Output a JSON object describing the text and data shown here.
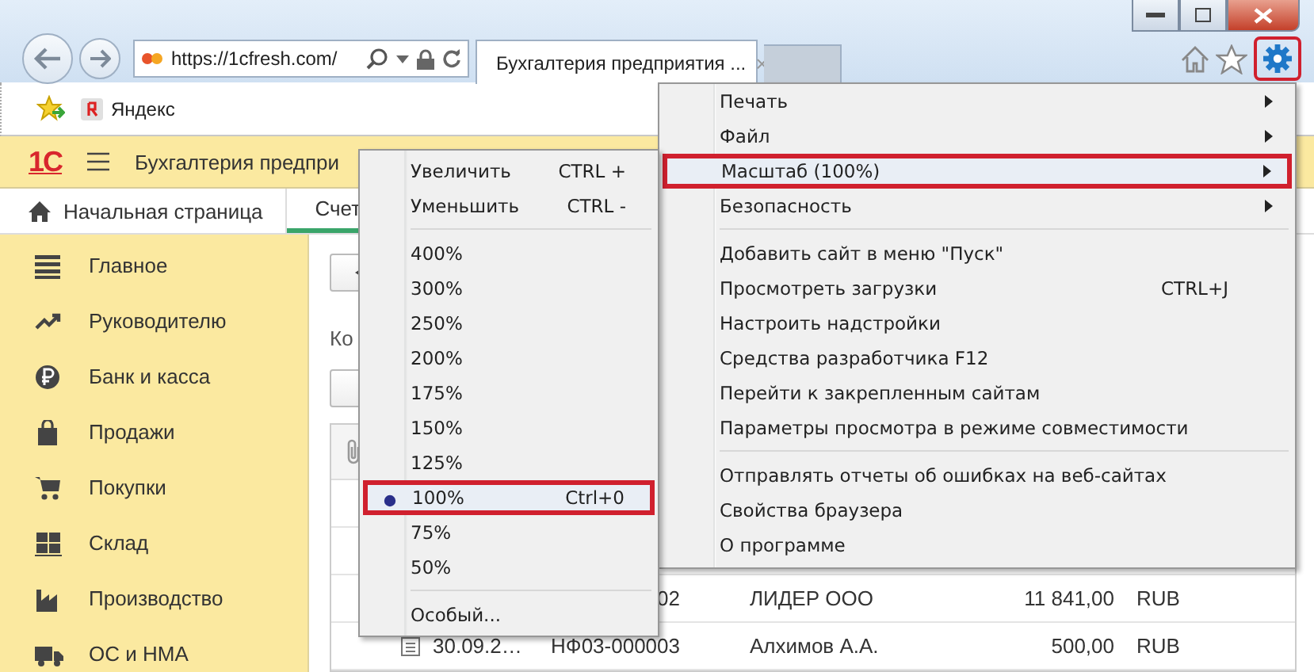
{
  "browser": {
    "address": "https://1cfresh.com/",
    "tab_title": "Бухгалтерия предприятия ...",
    "tab_close": "×",
    "gear_highlighted": true
  },
  "favorites": [
    {
      "label": "Яндекс"
    }
  ],
  "app": {
    "title": "Бухгалтерия предпри",
    "logo": "1С"
  },
  "tabs": [
    {
      "label": "Начальная страница",
      "selected": false,
      "kind": "home"
    },
    {
      "label": "Счет",
      "selected": true,
      "kind": "plain"
    }
  ],
  "sidebar": {
    "items": [
      {
        "label": "Главное",
        "kind": "lines"
      },
      {
        "label": "Руководителю",
        "kind": "trend"
      },
      {
        "label": "Банк и касса",
        "kind": "ruble"
      },
      {
        "label": "Продажи",
        "kind": "bag"
      },
      {
        "label": "Покупки",
        "kind": "cart"
      },
      {
        "label": "Склад",
        "kind": "grid"
      },
      {
        "label": "Производство",
        "kind": "factory"
      },
      {
        "label": "ОС и НМА",
        "kind": "truck"
      }
    ]
  },
  "content": {
    "label": "Ко",
    "rows": [
      {
        "number": "02",
        "counterparty": "ЛИДЕР ООО",
        "amount": "11 841,00",
        "currency": "RUB"
      },
      {
        "date": "30.09.2…",
        "number": "НФ03-000003",
        "counterparty": "Алхимов А.А.",
        "amount": "500,00",
        "currency": "RUB"
      }
    ]
  },
  "tools_menu": [
    {
      "kind": "item",
      "label": "Печать",
      "has_submenu": true,
      "highlighted": false
    },
    {
      "kind": "item",
      "label": "Файл",
      "has_submenu": true,
      "highlighted": false
    },
    {
      "kind": "item",
      "label": "Масштаб (100%)",
      "has_submenu": true,
      "highlighted": true
    },
    {
      "kind": "item",
      "label": "Безопасность",
      "has_submenu": true,
      "highlighted": false
    },
    {
      "kind": "separator"
    },
    {
      "kind": "item",
      "label": "Добавить сайт в меню \"Пуск\"",
      "has_submenu": false,
      "highlighted": false
    },
    {
      "kind": "item",
      "label": "Просмотреть загрузки",
      "shortcut": "CTRL+J",
      "has_submenu": false,
      "highlighted": false
    },
    {
      "kind": "item",
      "label": "Настроить надстройки",
      "has_submenu": false,
      "highlighted": false
    },
    {
      "kind": "item",
      "label": "Средства разработчика F12",
      "has_submenu": false,
      "highlighted": false
    },
    {
      "kind": "item",
      "label": "Перейти к закрепленным сайтам",
      "has_submenu": false,
      "highlighted": false
    },
    {
      "kind": "item",
      "label": "Параметры просмотра в режиме совместимости",
      "has_submenu": false,
      "highlighted": false
    },
    {
      "kind": "separator"
    },
    {
      "kind": "item",
      "label": "Отправлять отчеты об ошибках на веб-сайтах",
      "has_submenu": false,
      "highlighted": false
    },
    {
      "kind": "item",
      "label": "Свойства браузера",
      "has_submenu": false,
      "highlighted": false
    },
    {
      "kind": "item",
      "label": "О программе",
      "has_submenu": false,
      "highlighted": false
    }
  ],
  "zoom_menu": [
    {
      "kind": "item",
      "label": "Увеличить",
      "shortcut": "CTRL +",
      "selected": false,
      "highlighted": false
    },
    {
      "kind": "item",
      "label": "Уменьшить",
      "shortcut": "CTRL -",
      "selected": false,
      "highlighted": false
    },
    {
      "kind": "separator"
    },
    {
      "kind": "item",
      "label": "400%",
      "selected": false,
      "highlighted": false
    },
    {
      "kind": "item",
      "label": "300%",
      "selected": false,
      "highlighted": false
    },
    {
      "kind": "item",
      "label": "250%",
      "selected": false,
      "highlighted": false
    },
    {
      "kind": "item",
      "label": "200%",
      "selected": false,
      "highlighted": false
    },
    {
      "kind": "item",
      "label": "175%",
      "selected": false,
      "highlighted": false
    },
    {
      "kind": "item",
      "label": "150%",
      "selected": false,
      "highlighted": false
    },
    {
      "kind": "item",
      "label": "125%",
      "selected": false,
      "highlighted": false
    },
    {
      "kind": "item",
      "label": "100%",
      "shortcut": "Ctrl+0",
      "selected": true,
      "highlighted": true
    },
    {
      "kind": "item",
      "label": "75%",
      "selected": false,
      "highlighted": false
    },
    {
      "kind": "item",
      "label": "50%",
      "selected": false,
      "highlighted": false
    },
    {
      "kind": "separator"
    },
    {
      "kind": "item",
      "label": "Особый...",
      "selected": false,
      "highlighted": false
    }
  ]
}
